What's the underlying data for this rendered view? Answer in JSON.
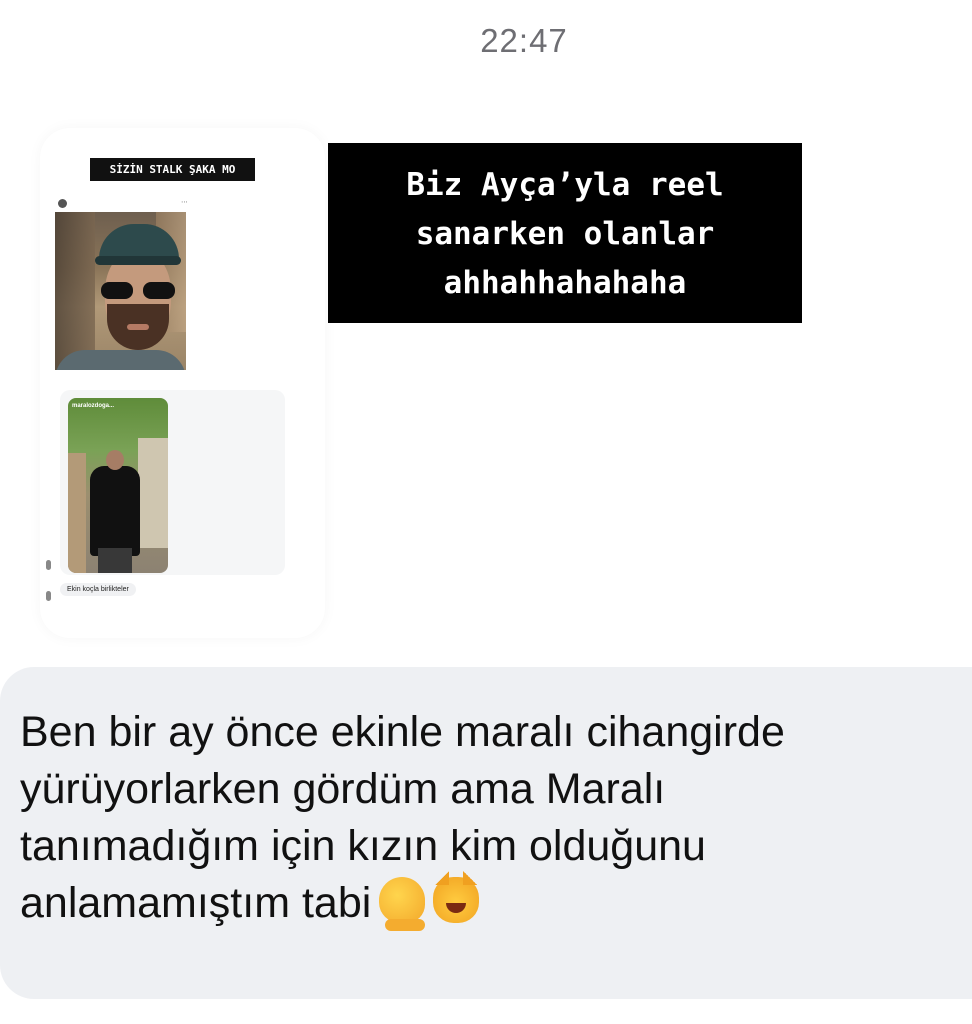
{
  "timestamp": "22:47",
  "shared_story": {
    "caption": "SİZİN STALK ŞAKA MO",
    "reply_bubble_text": "Ekin koçla birlikteler",
    "embedded_reply_username": "maralozdoga..."
  },
  "story_overlay_text": {
    "lines": [
      "Biz Ayça’yla reel",
      "sanarken olanlar",
      "ahhahhahahaha"
    ]
  },
  "message": {
    "lines": [
      "Ben bir ay önce ekinle maralı cihangirde",
      "yürüyorlarken gördüm ama Maralı",
      "tanımadığım için kızın kim olduğunu",
      "anlamamıştım tabi"
    ],
    "emojis": [
      "melting-face",
      "cat-with-tears-of-joy"
    ]
  },
  "colors": {
    "bubble_bg": "#eef0f3",
    "timestamp": "#6e6e73",
    "overlay_bg": "#000000"
  }
}
